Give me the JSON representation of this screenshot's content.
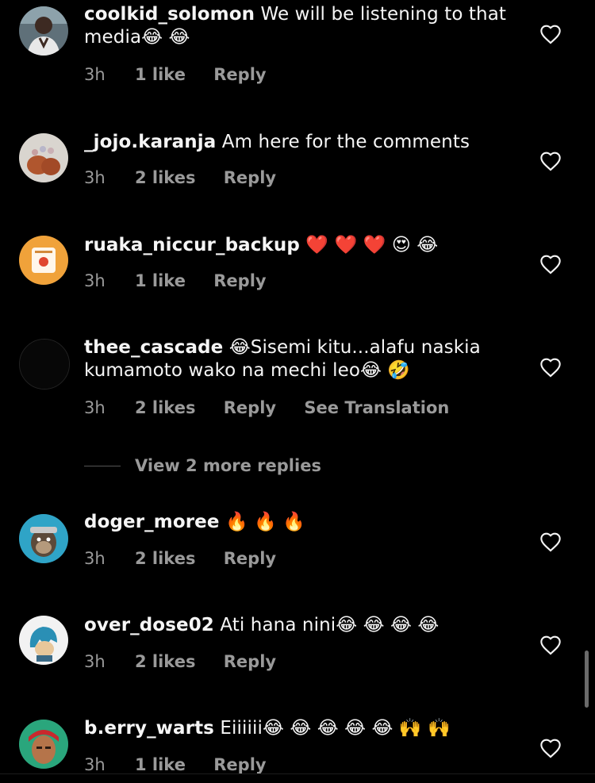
{
  "comments": [
    {
      "username": "coolkid_solomon",
      "text": "We will be listening to that media😂 😂",
      "time": "3h",
      "likes": "1 like",
      "reply": "Reply",
      "avatar_icon": "person-avatar"
    },
    {
      "username": "_jojo.karanja",
      "text": "Am here for the comments",
      "time": "3h",
      "likes": "2 likes",
      "reply": "Reply",
      "avatar_icon": "hands-avatar"
    },
    {
      "username": "ruaka_niccur_backup",
      "text": "❤️ ❤️ ❤️ 😍 😂",
      "time": "3h",
      "likes": "1 like",
      "reply": "Reply",
      "avatar_icon": "orange-logo-avatar"
    },
    {
      "username": "thee_cascade",
      "text": "😂Sisemi kitu...alafu naskia kumamoto wako na mechi leo😂 🤣",
      "time": "3h",
      "likes": "2 likes",
      "reply": "Reply",
      "translation": "See Translation",
      "avatar_icon": "dark-avatar"
    },
    {
      "username": "doger_moree",
      "text": "🔥 🔥 🔥",
      "time": "3h",
      "likes": "2 likes",
      "reply": "Reply",
      "avatar_icon": "ape-avatar"
    },
    {
      "username": "over_dose02",
      "text": "Ati hana nini😂 😂 😂 😂",
      "time": "3h",
      "likes": "2 likes",
      "reply": "Reply",
      "avatar_icon": "cartoon-avatar"
    },
    {
      "username": "b.erry_warts",
      "text": "Eiiiiii😂 😂 😂 😂 😂 🙌 🙌",
      "time": "3h",
      "likes": "1 like",
      "reply": "Reply",
      "avatar_icon": "bandana-avatar"
    }
  ],
  "view_more_replies": "View 2 more replies",
  "colors": {
    "background": "#000000",
    "primary_text": "#f5f5f5",
    "secondary_text": "#9a9a9a"
  }
}
